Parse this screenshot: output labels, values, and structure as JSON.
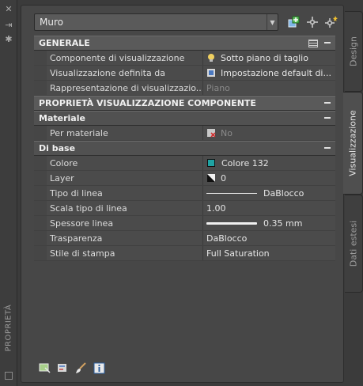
{
  "strip": {
    "title": "PROPRIETÀ"
  },
  "toolbar": {
    "selected_object": "Muro"
  },
  "sections": {
    "generale": {
      "title": "GENERALE",
      "rows": [
        {
          "name": "Componente di visualizzazione",
          "value": "Sotto piano di taglio"
        },
        {
          "name": "Visualizzazione definita da",
          "value": "Impostazione default di..."
        },
        {
          "name": "Rappresentazione di visualizzazio...",
          "value": "Piano"
        }
      ]
    },
    "proprieta": {
      "title": "PROPRIETÀ VISUALIZZAZIONE COMPONENTE"
    },
    "materiale": {
      "title": "Materiale",
      "rows": [
        {
          "name": "Per materiale",
          "value": "No"
        }
      ]
    },
    "dibase": {
      "title": "Di base",
      "rows": [
        {
          "name": "Colore",
          "value": "Colore 132"
        },
        {
          "name": "Layer",
          "value": "0"
        },
        {
          "name": "Tipo di linea",
          "value": "DaBlocco"
        },
        {
          "name": "Scala tipo di linea",
          "value": "1.00"
        },
        {
          "name": "Spessore linea",
          "value": "0.35 mm"
        },
        {
          "name": "Trasparenza",
          "value": "DaBlocco"
        },
        {
          "name": "Stile di stampa",
          "value": "Full Saturation"
        }
      ]
    }
  },
  "tabs": [
    {
      "label": "Design"
    },
    {
      "label": "Visualizzazione"
    },
    {
      "label": "Dati estesi"
    }
  ],
  "colors": {
    "color_132": "#1fa3a3",
    "bulb": "#f0d060"
  }
}
